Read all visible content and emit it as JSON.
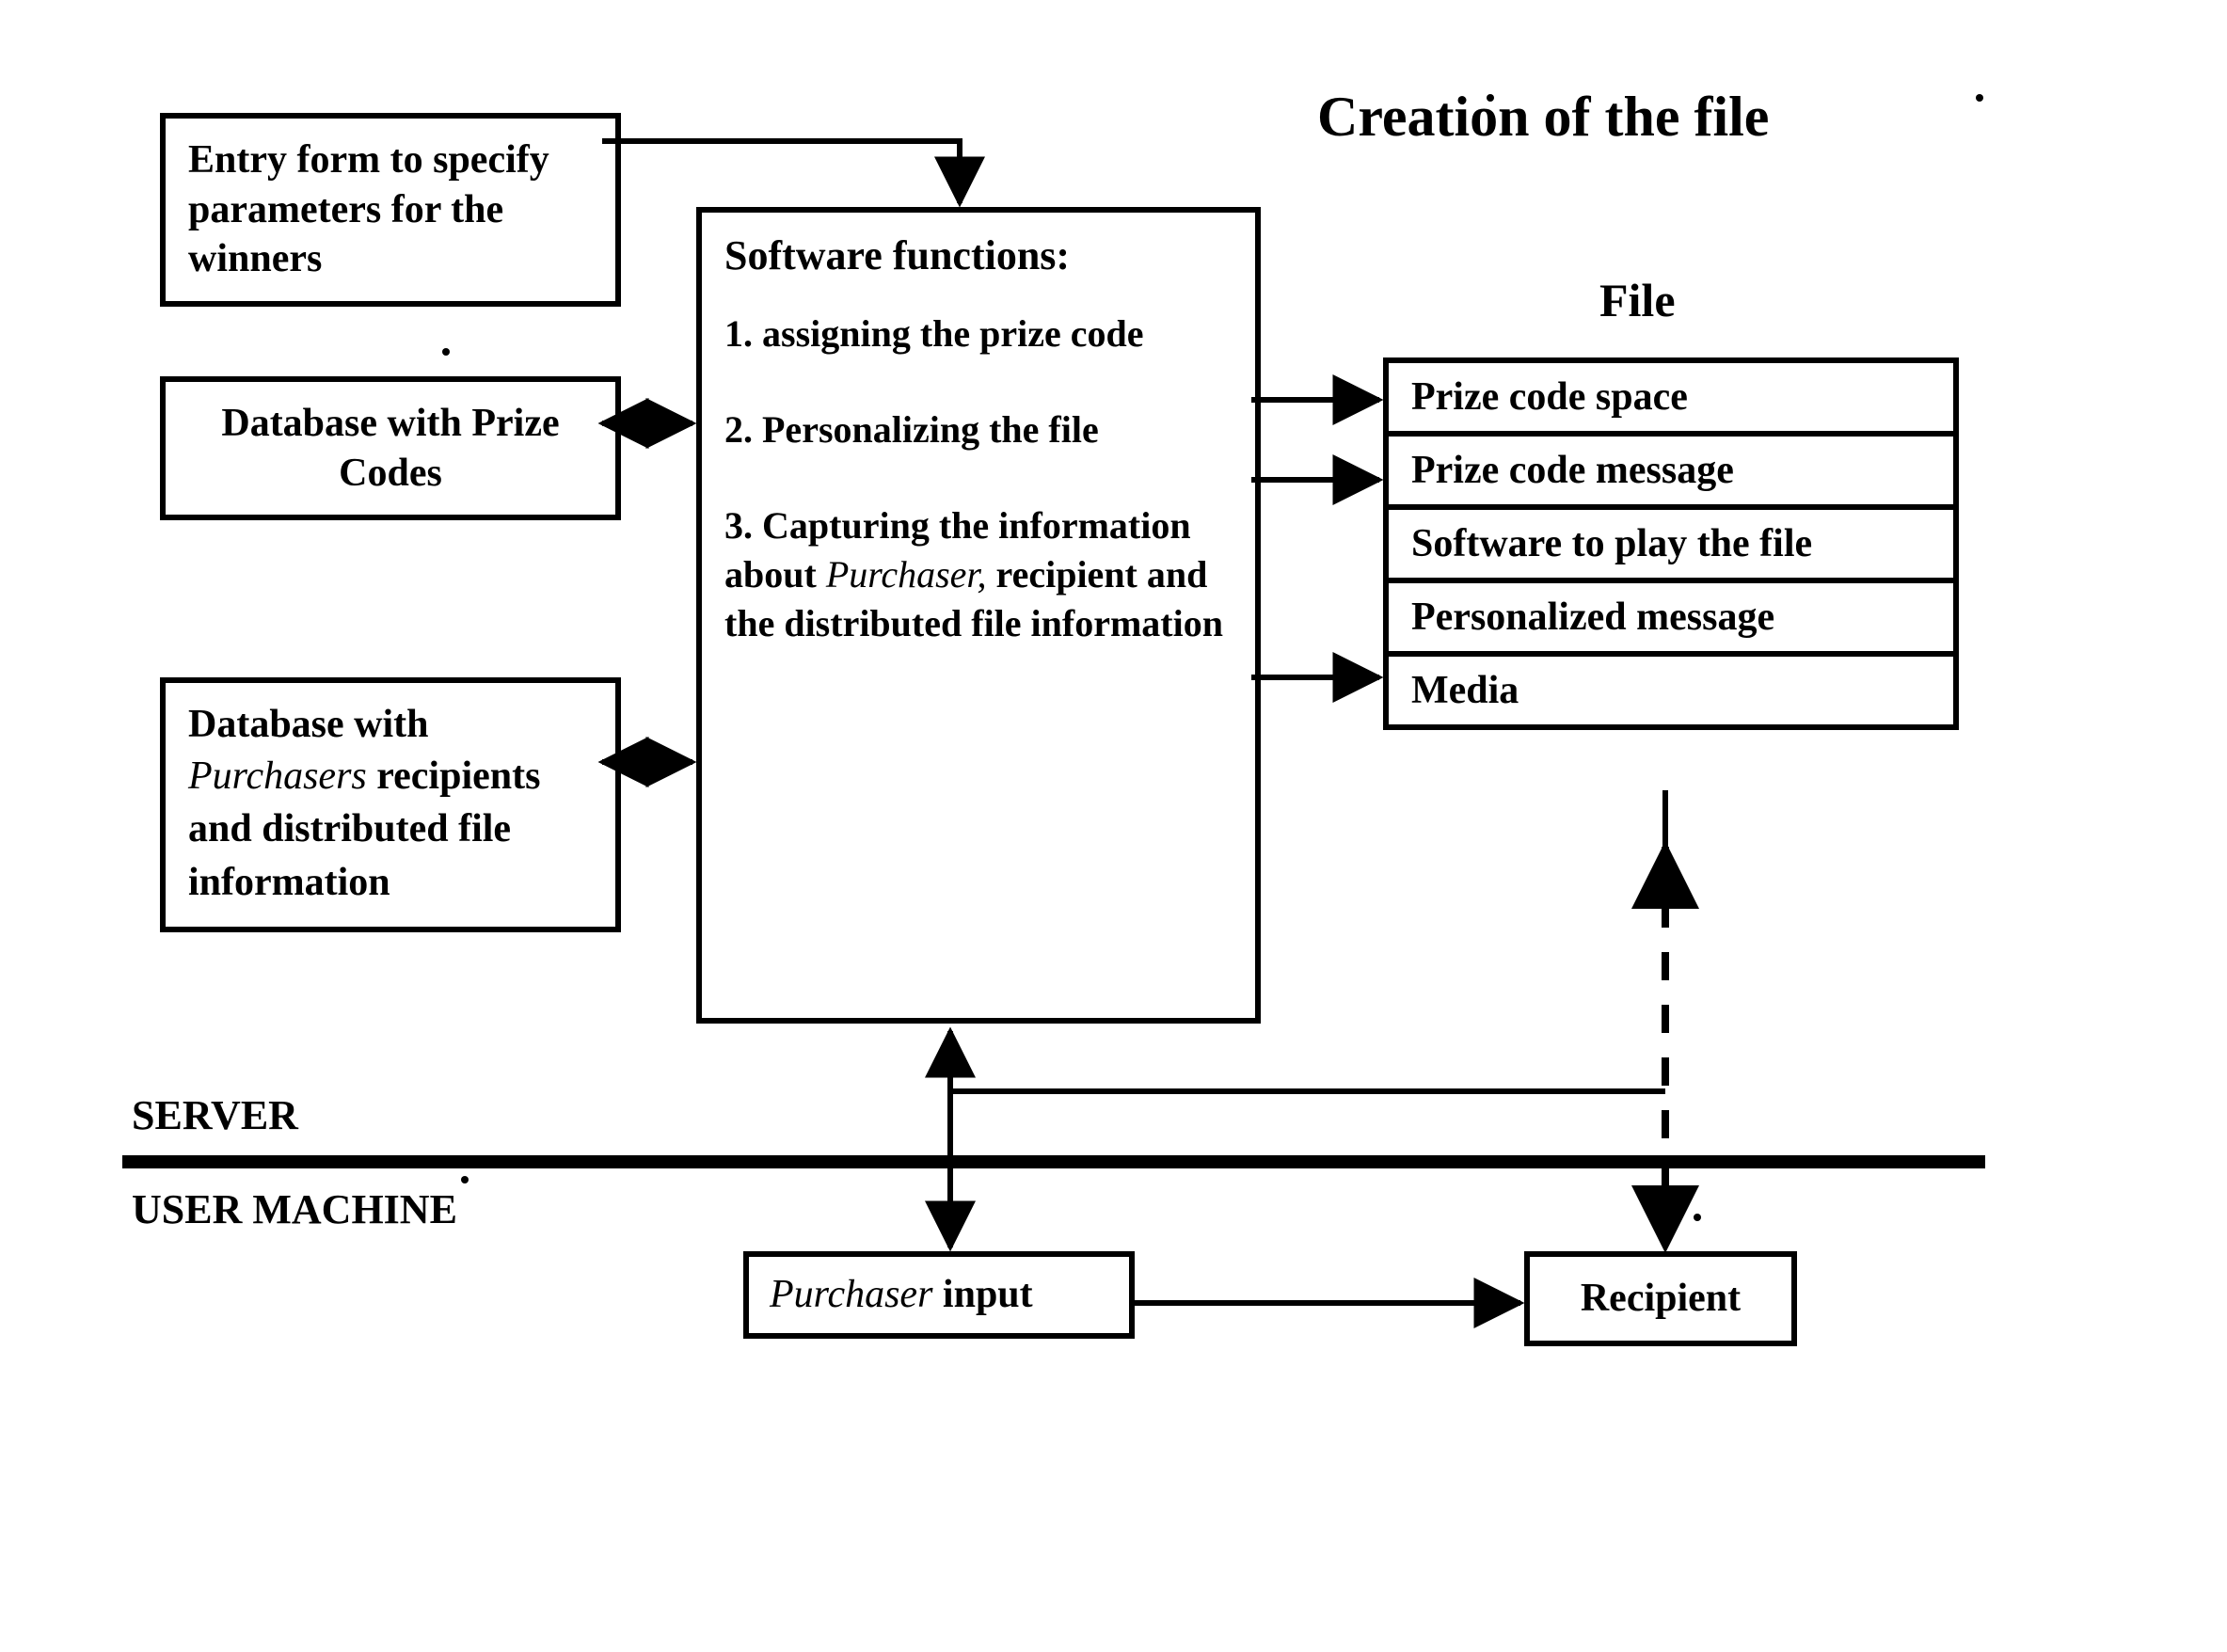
{
  "title": "Creation of the file",
  "file_heading": "File",
  "server_label": "SERVER",
  "user_label": "USER MACHINE",
  "entry_form": "Entry form to specify parameters for the winners",
  "db_codes": "Database with Prize Codes",
  "db_rec": {
    "line1": "Database with",
    "hw": "Purchasers",
    "rest": " recipients and distributed file information"
  },
  "software": {
    "heading": "Software functions:",
    "item1": "1. assigning the prize code",
    "item2": "2. Personalizing the file",
    "item3_a": "3. Capturing the information about ",
    "item3_hw": "Purchaser,",
    "item3_b": " recipient and the distributed file information"
  },
  "file_rows": {
    "r1": "Prize code space",
    "r2": "Prize code message",
    "r3": "Software to play the file",
    "r4": "Personalized message",
    "r5": "Media"
  },
  "purchaser_input": {
    "hw": "Purchaser",
    "rest": " input"
  },
  "recipient": "Recipient"
}
